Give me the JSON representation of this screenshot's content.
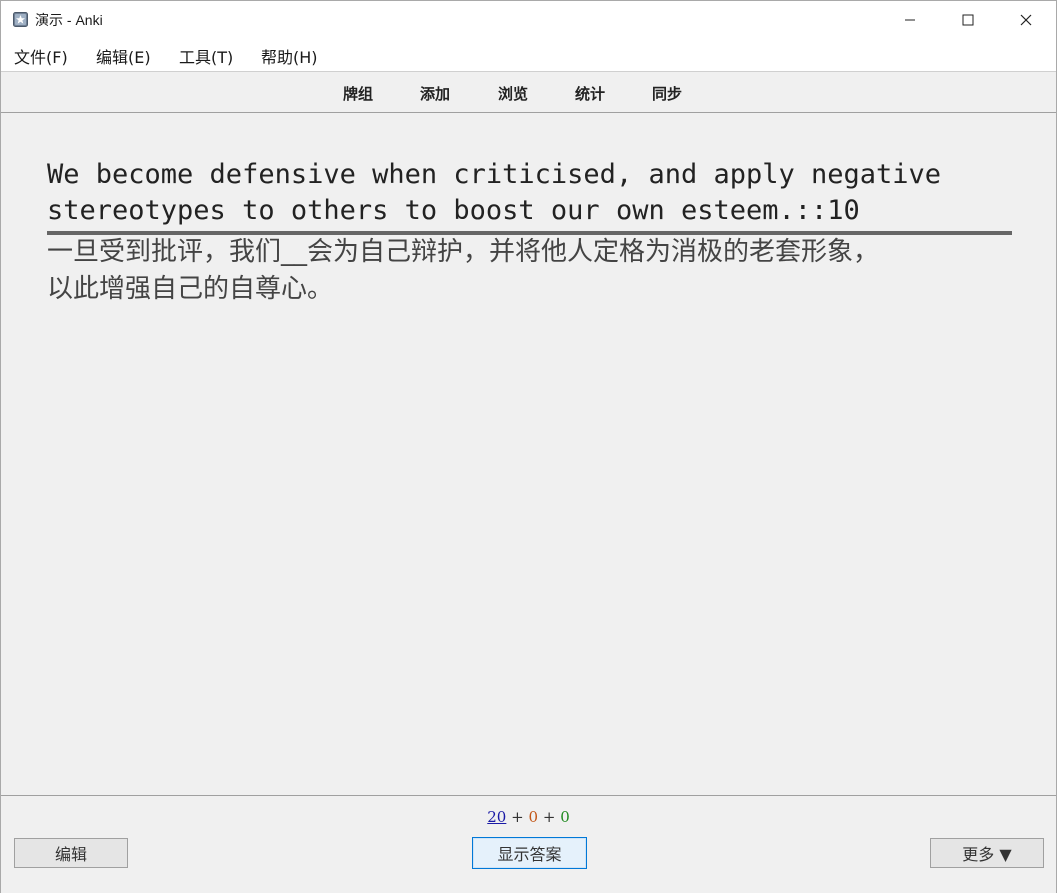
{
  "window": {
    "title": "演示 - Anki",
    "controls": {
      "minimize": "minimize-icon",
      "maximize": "maximize-icon",
      "close": "close-icon"
    }
  },
  "menubar": {
    "items": [
      "文件(F)",
      "编辑(E)",
      "工具(T)",
      "帮助(H)"
    ]
  },
  "toolbar": {
    "links": [
      "牌组",
      "添加",
      "浏览",
      "统计",
      "同步"
    ]
  },
  "card": {
    "front_line1": "We become defensive when criticised, and apply negative",
    "front_line2": "stereotypes to others to boost our own esteem.::10",
    "back_line1": "一旦受到批评，我们__会为自己辩护，并将他人定格为消极的老套形象，",
    "back_line2": "以此增强自己的自尊心。"
  },
  "bottombar": {
    "counts": {
      "new": "20",
      "learning": "0",
      "review": "0",
      "separator": "+"
    },
    "edit_label": "编辑",
    "show_answer_label": "显示答案",
    "more_label": "更多 ▼"
  },
  "colors": {
    "new": "#1a1aa6",
    "learning": "#c35617",
    "review": "#1f8a1f",
    "primary_border": "#0078d7"
  }
}
